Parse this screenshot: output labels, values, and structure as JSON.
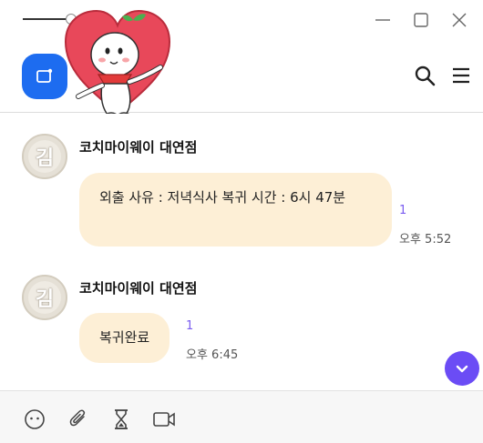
{
  "messages": [
    {
      "sender": "코치마이웨이 대연점",
      "avatar_glyph": "김",
      "text": "외출 사유 : 저녁식사 복귀 시간 : 6시 47분",
      "read_count": "1",
      "time": "오후 5:52"
    },
    {
      "sender": "코치마이웨이 대연점",
      "avatar_glyph": "김",
      "text": "복귀완료",
      "read_count": "1",
      "time": "오후 6:45"
    }
  ],
  "icons": {
    "window": [
      "minimize-icon",
      "maximize-icon",
      "close-icon"
    ],
    "header": [
      "new-chat-icon",
      "search-icon",
      "menu-icon"
    ],
    "footer": [
      "emoji-icon",
      "attach-icon",
      "hourglass-icon",
      "video-icon"
    ],
    "scroll": "chevron-down-icon"
  },
  "colors": {
    "accent_blue": "#1d6cf0",
    "bubble": "#fdefd6",
    "scroll_button": "#6b4cf5",
    "read_count": "#7a5cf0",
    "mascot_heart": "#e8485a"
  }
}
